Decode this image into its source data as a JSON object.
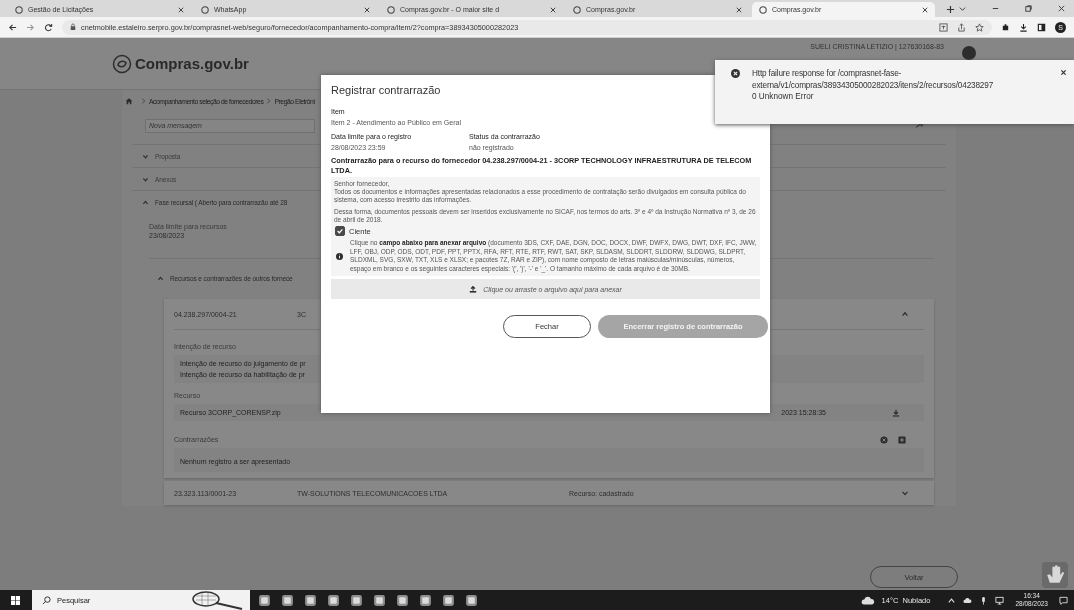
{
  "browser": {
    "tabs": [
      {
        "title": "Gestão de Licitações",
        "selected": false
      },
      {
        "title": "WhatsApp",
        "selected": false
      },
      {
        "title": "Compras.gov.br - O maior site d",
        "selected": false
      },
      {
        "title": "Compras.gov.br",
        "selected": false
      },
      {
        "title": "Compras.gov.br",
        "selected": true
      }
    ],
    "url": "cnetmobile.estaleiro.serpro.gov.br/comprasnet-web/seguro/fornecedor/acompanhamento-compra/item/2?compra=38934305000282023",
    "profile_initial": "S"
  },
  "header": {
    "logo": "Compras.gov.br",
    "user": "SUELI CRISTINA LETIZIO | 127630168-83"
  },
  "breadcrumb": [
    "Acompanhamento seleção de fornecedores",
    "Pregão Eletrôni"
  ],
  "message": {
    "placeholder": "Nova mensagem"
  },
  "sections": [
    {
      "label": "Proposta",
      "expanded": false
    },
    {
      "label": "Anexos",
      "expanded": false
    },
    {
      "label": "Fase recursal  ( Aberto para contrarrazão até 28",
      "expanded": true
    }
  ],
  "deadline": {
    "label": "Data limite para recursos",
    "value": "23/08/2023"
  },
  "subsection": {
    "label": "Recursos e contrarrazões de outros fornece",
    "expanded": true
  },
  "suppliers": [
    {
      "cnpj": "04.238.297/0004-21",
      "name": "3C",
      "expanded": true,
      "details": {
        "intent_label": "Intenção de recurso",
        "intents": [
          "Intenção de recurso do julgamento de pr",
          "Intenção de recurso da habilitação de pr"
        ],
        "appeal_label": "Recurso",
        "appeal_file": "Recurso 3CORP_CORENSP.zip",
        "appeal_time": "2023 15:28:35",
        "counter_label": "Contrarrazões",
        "counter_text": "Nenhum registro a ser apresentado"
      }
    },
    {
      "cnpj": "23.323.113/0001-23",
      "name": "TW-SOLUTIONS TELECOMUNICACOES LTDA",
      "status": "Recurso: cadastrado",
      "expanded": false
    }
  ],
  "back_button": "Voltar",
  "modal": {
    "title": "Registrar contrarrazão",
    "item_label": "Item",
    "item_value": "Item 2 - Atendimento ao Público em Geral",
    "deadline_label": "Data limite para o registro",
    "deadline_value": "28/08/2023 23:59",
    "status_label": "Status da contrarrazão",
    "status_value": "não registrado",
    "heading": "Contrarrazão para o recurso do fornecedor 04.238.297/0004-21 - 3CORP TECHNOLOGY INFRAESTRUTURA DE TELECOM LTDA.",
    "notice": [
      "Senhor fornecedor,",
      "Todos os documentos e informações apresentadas relacionados a esse procedimento de contratação serão divulgados em consulta pública do sistema, com acesso irrestrito das informações.",
      "Dessa forma, documentos pessoais devem ser inseridos exclusivamente no SICAF, nos termos do arts. 3º e 4º da Instrução Normativa nº 3, de 26 de abril de 2018."
    ],
    "ciente": {
      "label": "Ciente",
      "checked": true
    },
    "info": "Clique no **campo abaixo para anexar arquivo** (documento 3DS, CXF, DAE, DGN, DOC, DOCX, DWF, DWFX, DWG, DWT, DXF, IFC, JWW, LFF, OBJ, ODP, ODS, ODT, PDF, PPT, PPTX, RFA, RFT, RTE, RTF, RWT, SAT, SKP, SLDASM, SLDDRT, SLDDRW, SLDDWG, SLDPRT, SLDXML, SVG, SXW, TXT, XLS e XLSX; e pacotes 7Z, RAR e ZIP), com nome composto de letras maiúsculas/minúsculas, números, espaço em branco e os seguintes caracteres especiais: '(', ')', '-' e '_'. O tamanho máximo de cada arquivo é de 30MB.",
    "upload": "Clique ou arraste o arquivo aqui para anexar",
    "buttons": [
      {
        "label": "Fechar",
        "kind": "secondary",
        "disabled": false
      },
      {
        "label": "Encerrar registro de contrarrazão",
        "kind": "primary",
        "disabled": true
      }
    ]
  },
  "toast": {
    "message": "Http failure response for /comprasnet-fase-externa/v1/compras/38934305000282023/itens/2/recursos/04238297",
    "detail": "0 Unknown Error"
  },
  "taskbar": {
    "search": "Pesquisar",
    "weather": "14°C  Nublado",
    "time": "16:34",
    "date": "28/08/2023"
  }
}
